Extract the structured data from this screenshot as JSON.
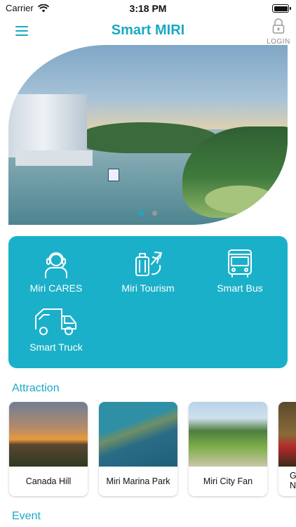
{
  "status": {
    "carrier": "Carrier",
    "time": "3:18 PM"
  },
  "header": {
    "title": "Smart MIRI",
    "login_label": "LOGIN",
    "menu_icon": "hamburger-icon",
    "login_icon": "padlock-icon"
  },
  "banner": {
    "slides_count": 2,
    "active_slide": 1
  },
  "services": [
    {
      "label": "Miri CARES",
      "icon": "headset-agent-icon"
    },
    {
      "label": "Miri Tourism",
      "icon": "luggage-plane-icon"
    },
    {
      "label": "Smart Bus",
      "icon": "bus-icon"
    },
    {
      "label": "Smart Truck",
      "icon": "truck-icon"
    }
  ],
  "attraction": {
    "title": "Attraction",
    "items": [
      {
        "label": "Canada Hill"
      },
      {
        "label": "Miri Marina Park"
      },
      {
        "label": "Miri City Fan"
      },
      {
        "label": "G\nN"
      }
    ]
  },
  "event": {
    "title": "Event"
  },
  "colors": {
    "accent": "#1aa9c4",
    "panel": "#1bb0c9",
    "text": "#111111",
    "muted": "#8a8a8a"
  }
}
